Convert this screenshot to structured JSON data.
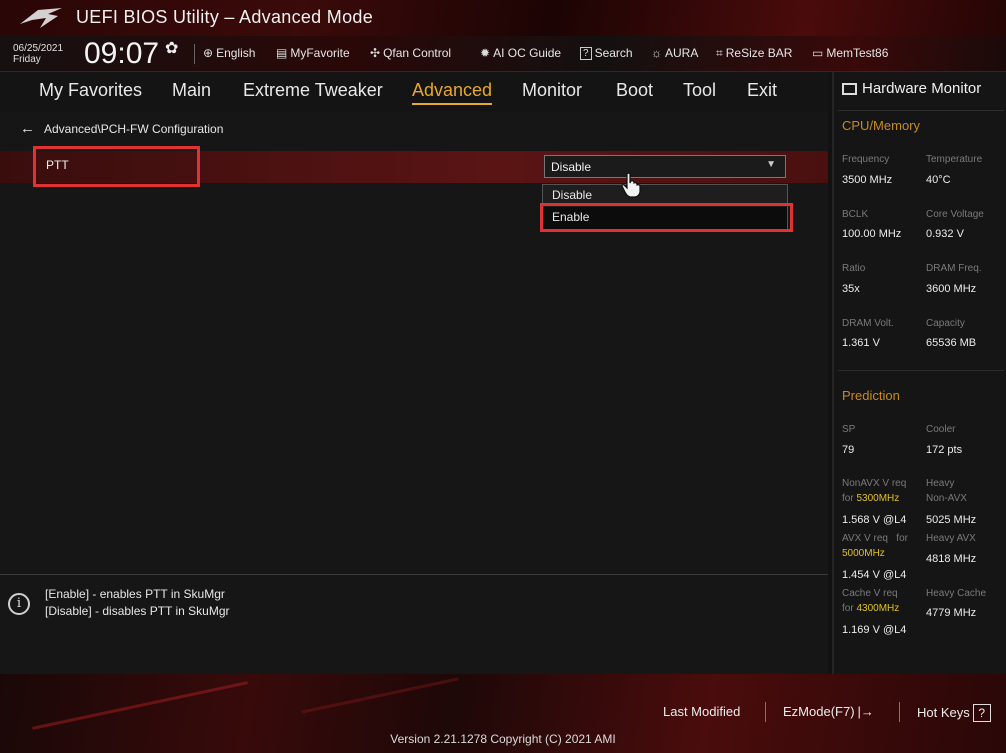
{
  "header": {
    "app_title": "UEFI BIOS Utility – Advanced Mode",
    "date": "06/25/2021",
    "day": "Friday",
    "time": "09:07",
    "tools": [
      "English",
      "MyFavorite",
      "Qfan Control",
      "AI OC Guide",
      "Search",
      "AURA",
      "ReSize BAR",
      "MemTest86"
    ]
  },
  "menu": {
    "items": [
      "My Favorites",
      "Main",
      "Extreme Tweaker",
      "Advanced",
      "Monitor",
      "Boot",
      "Tool",
      "Exit"
    ],
    "active": "Advanced"
  },
  "main": {
    "breadcrumb": "Advanced\\PCH-FW Configuration",
    "setting_label": "PTT",
    "dropdown_value": "Disable",
    "options": [
      "Disable",
      "Enable"
    ],
    "highlighted_option": "Enable"
  },
  "help": {
    "lines": [
      "[Enable] - enables PTT in SkuMgr",
      "[Disable] - disables PTT in SkuMgr"
    ]
  },
  "hardware_monitor": {
    "title": "Hardware Monitor",
    "cpu_memory": {
      "section": "CPU/Memory",
      "frequency_label": "Frequency",
      "frequency": "3500 MHz",
      "temperature_label": "Temperature",
      "temperature": "40°C",
      "bclk_label": "BCLK",
      "bclk": "100.00 MHz",
      "core_voltage_label": "Core Voltage",
      "core_voltage": "0.932 V",
      "ratio_label": "Ratio",
      "ratio": "35x",
      "dram_freq_label": "DRAM Freq.",
      "dram_freq": "3600 MHz",
      "dram_volt_label": "DRAM Volt.",
      "dram_volt": "1.361 V",
      "capacity_label": "Capacity",
      "capacity": "65536 MB"
    },
    "prediction": {
      "section": "Prediction",
      "sp_label": "SP",
      "sp": "79",
      "cooler_label": "Cooler",
      "cooler": "172 pts",
      "nonavx_label": "NonAVX V req",
      "for_word": "for",
      "nonavx_freq": "5300MHz",
      "nonavx_v": "1.568 V @L4",
      "heavy_label": "Heavy",
      "heavy_nonavx_label": "Non-AVX",
      "heavy_nonavx": "5025 MHz",
      "avx_label": "AVX V req",
      "avx_freq": "5000MHz",
      "avx_v": "1.454 V @L4",
      "heavy_avx_label": "Heavy AVX",
      "heavy_avx": "4818 MHz",
      "cache_label": "Cache V req",
      "cache_freq": "4300MHz",
      "cache_v": "1.169 V @L4",
      "heavy_cache_label": "Heavy Cache",
      "heavy_cache": "4779 MHz"
    }
  },
  "footer": {
    "last_modified": "Last Modified",
    "ezmode": "EzMode(F7)",
    "hot_keys": "Hot Keys",
    "hot_keys_key": "?",
    "version": "Version 2.21.1278 Copyright (C) 2021 AMI"
  },
  "colors": {
    "accent": "#e8a82c",
    "highlight_box": "#e03232",
    "section_title": "#c88a1e",
    "value_yellow": "#e0c020"
  }
}
